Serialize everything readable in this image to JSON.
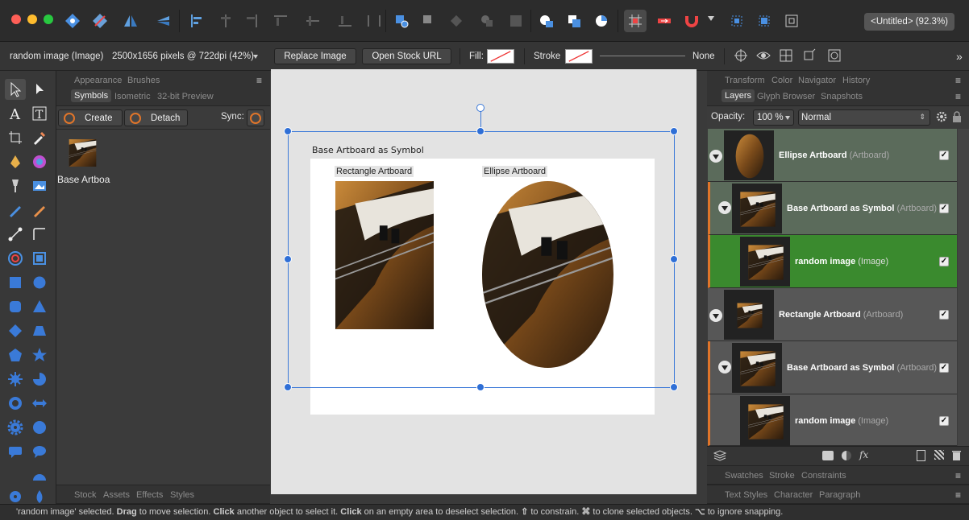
{
  "window": {
    "title": "<Untitled> (92.3%)"
  },
  "context_bar": {
    "selection_name": "random image (Image)",
    "pixel_info": "2500x1656 pixels @ 722dpi (42%)",
    "replace_image": "Replace Image",
    "open_stock_url": "Open Stock URL",
    "fill_label": "Fill:",
    "stroke_label": "Stroke",
    "stroke_value": "None"
  },
  "left_panel": {
    "top_tabs": [
      "Appearance",
      "Brushes"
    ],
    "tabs": [
      "Symbols",
      "Isometric",
      "32-bit Preview"
    ],
    "create_label": "Create",
    "detach_label": "Detach",
    "sync_label": "Sync:",
    "symbol_name": "Base Artboa",
    "bottom_tabs": [
      "Stock",
      "Assets",
      "Effects",
      "Styles"
    ]
  },
  "canvas": {
    "symbol_title": "Base Artboard as Symbol",
    "rect_label": "Rectangle Artboard",
    "ellipse_label": "Ellipse Artboard"
  },
  "right_panel": {
    "top_tabs": [
      "Transform",
      "Color",
      "Navigator",
      "History"
    ],
    "tabs": [
      "Layers",
      "Glyph Browser",
      "Snapshots"
    ],
    "opacity_label": "Opacity:",
    "opacity_value": "100 %",
    "blend_mode": "Normal",
    "layers": [
      {
        "name": "Ellipse Artboard",
        "type": "(Artboard)"
      },
      {
        "name": "Base Artboard as Symbol",
        "type": "(Artboard)"
      },
      {
        "name": "random image",
        "type": "(Image)"
      },
      {
        "name": "Rectangle Artboard",
        "type": "(Artboard)"
      },
      {
        "name": "Base Artboard as Symbol",
        "type": "(Artboard)"
      },
      {
        "name": "random image",
        "type": "(Image)"
      }
    ],
    "bottom_tabs_1": [
      "Swatches",
      "Stroke",
      "Constraints"
    ],
    "bottom_tabs_2": [
      "Text Styles",
      "Character",
      "Paragraph"
    ]
  },
  "status": {
    "p1": "'random image' selected. ",
    "b1": "Drag",
    "p2": " to move selection. ",
    "b2": "Click",
    "p3": " another object to select it. ",
    "b3": "Click",
    "p4": " on an empty area to deselect selection. ",
    "k1": "⇧",
    "p5": " to constrain. ",
    "k2": "⌘",
    "p6": " to clone selected objects. ",
    "k3": "⌥",
    "p7": " to ignore snapping."
  },
  "colors": {
    "accent": "#2f6fd6",
    "selected_layer": "#3a8a2e",
    "symbol_layer": "#5a6b5a"
  }
}
